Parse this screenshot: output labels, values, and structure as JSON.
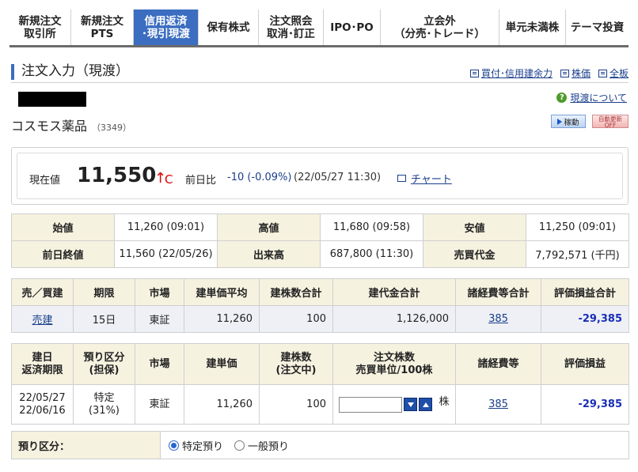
{
  "nav": {
    "tabs": [
      {
        "label": "新規注文\n取引所",
        "active": false
      },
      {
        "label": "新規注文\nPTS",
        "active": false
      },
      {
        "label": "信用返済\n･現引現渡",
        "active": true
      },
      {
        "label": "保有株式",
        "active": false
      },
      {
        "label": "注文照会\n取消･訂正",
        "active": false
      },
      {
        "label": "IPO･PO",
        "active": false
      },
      {
        "label": "立会外\n（分売･トレード）",
        "active": false
      },
      {
        "label": "単元未満株",
        "active": false
      },
      {
        "label": "テーマ投資",
        "active": false
      }
    ]
  },
  "page": {
    "title": "注文入力（現渡）",
    "links": {
      "buying_power": "買付･信用建余力",
      "stock_price": "株価",
      "board": "全板"
    }
  },
  "help": {
    "icon": "?",
    "label": "現渡について"
  },
  "stock": {
    "name": "コスモス薬品",
    "code": "（3349）"
  },
  "buttons": {
    "run": "稼動",
    "auto_update": "自動更新\nOFF"
  },
  "price": {
    "label": "現在値",
    "value": "11,550",
    "arrow": "↑",
    "flag": "C",
    "change_label": "前日比",
    "change": "-10 (-0.09%)",
    "datetime": "(22/05/27 11:30)",
    "chart_link": "チャート"
  },
  "quote": {
    "rows": [
      [
        {
          "label": "始値",
          "value": "11,260 (09:01)"
        },
        {
          "label": "高値",
          "value": "11,680 (09:58)"
        },
        {
          "label": "安値",
          "value": "11,250 (09:01)"
        }
      ],
      [
        {
          "label": "前日終値",
          "value": "11,560 (22/05/26)"
        },
        {
          "label": "出来高",
          "value": "687,800 (11:30)"
        },
        {
          "label": "売買代金",
          "value": "7,792,571 (千円)"
        }
      ]
    ]
  },
  "position": {
    "headers": [
      "売／買建",
      "期限",
      "市場",
      "建単価平均",
      "建株数合計",
      "建代金合計",
      "諸経費等合計",
      "評価損益合計"
    ],
    "row": {
      "side": "売建",
      "term": "15日",
      "market": "東証",
      "avg_price": "11,260",
      "qty": "100",
      "amount": "1,126,000",
      "fees": "385",
      "pnl": "-29,385"
    }
  },
  "order": {
    "headers": [
      "建日\n返済期限",
      "預り区分\n(担保)",
      "市場",
      "建単価",
      "建株数\n(注文中)",
      "注文株数\n売買単位/100株",
      "諸経費等",
      "評価損益"
    ],
    "row": {
      "open_date": "22/05/27",
      "due_date": "22/06/16",
      "deposit": "特定",
      "deposit_pct": "(31%)",
      "market": "東証",
      "price": "11,260",
      "qty": "100",
      "order_qty": "",
      "unit": "株",
      "fees": "385",
      "pnl": "-29,385"
    }
  },
  "deposit_type": {
    "label": "預り区分：",
    "options": [
      {
        "label": "特定預り",
        "selected": true
      },
      {
        "label": "一般預り",
        "selected": false
      }
    ]
  },
  "colors": {
    "accent": "#3b6dc0",
    "up": "#dd0000",
    "loss": "#1a2eb8",
    "header_bg": "#f6f2e0"
  }
}
